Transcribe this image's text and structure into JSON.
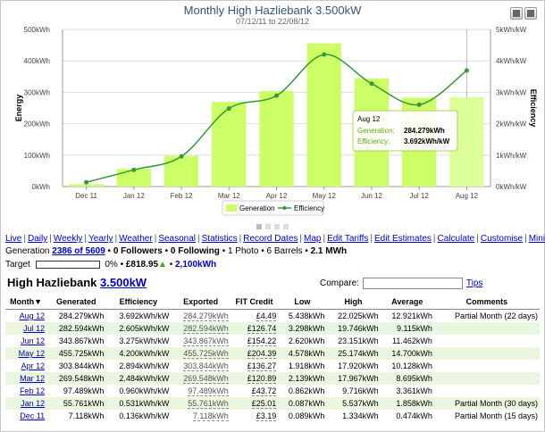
{
  "chart": {
    "title": "Monthly High Hazliebank 3.500kW",
    "subtitle": "07/12/11 to 22/08/12",
    "colors": {
      "bar": "#ccff66",
      "bar_highlight": "#ddff99",
      "line": "#339933",
      "tooltip_border": "#a8d060",
      "tooltip_label": "#66aa22"
    },
    "tooltip": {
      "month": "Aug 12",
      "rows": [
        {
          "label": "Generation:",
          "value": "284.279kWh"
        },
        {
          "label": "Efficiency:",
          "value": "3.692kWh/kW"
        }
      ]
    }
  },
  "chart_data": {
    "type": "bar",
    "categories": [
      "Dec 11",
      "Jan 12",
      "Feb 12",
      "Mar 12",
      "Apr 12",
      "May 12",
      "Jun 12",
      "Jul 12",
      "Aug 12"
    ],
    "series": [
      {
        "name": "Generation",
        "type": "bar",
        "axis": "left",
        "values": [
          7.118,
          55.761,
          97.489,
          269.548,
          303.844,
          455.725,
          343.867,
          282.594,
          284.279
        ]
      },
      {
        "name": "Efficiency",
        "type": "line",
        "axis": "right",
        "values": [
          0.136,
          0.531,
          0.96,
          2.484,
          2.894,
          4.2,
          3.275,
          2.605,
          3.692
        ]
      }
    ],
    "ylabel": "Energy",
    "y2label": "Efficiency",
    "ylim": [
      0,
      500
    ],
    "y2lim": [
      0,
      5
    ],
    "yticks": [
      "0kWh",
      "100kWh",
      "200kWh",
      "300kWh",
      "400kWh",
      "500kWh"
    ],
    "y2ticks": [
      "0kWh/kW",
      "1kWh/kW",
      "2kWh/kW",
      "3kWh/kW",
      "4kWh/kW",
      "5kWh/kW"
    ],
    "grid": true,
    "legend": "bottom"
  },
  "nav": {
    "links": [
      "Live",
      "Daily",
      "Weekly",
      "Yearly",
      "Weather",
      "Seasonal",
      "Statistics",
      "Record Dates",
      "Map",
      "Edit Tariffs",
      "Edit Estimates",
      "Calculate",
      "Customise",
      "Minimise"
    ]
  },
  "stats": {
    "prefix": "Generation ",
    "rank": "2386 of 5609",
    "followers": "0 Followers",
    "following": "0 Following",
    "photo": "1 Photo",
    "barrels": "6 Barrels",
    "mwh": "2.1 MWh"
  },
  "target": {
    "label": "Target",
    "progress": 0,
    "percent": "0%",
    "money": "£818.95",
    "kwh": "2,100kWh"
  },
  "system": {
    "name": "High Hazliebank",
    "size": "3.500kW"
  },
  "compare": {
    "label": "Compare:",
    "placeholder": "",
    "tips": "Tips"
  },
  "table": {
    "headers": [
      "Month▼",
      "Generated",
      "Efficiency",
      "Exported",
      "FIT Credit",
      "Low",
      "High",
      "Average",
      "Comments"
    ],
    "rows": [
      {
        "month": "Aug 12",
        "generated": "284.279kWh",
        "efficiency": "3.692kWh/kW",
        "exported": "284.279kWh",
        "fit": "£4.49",
        "low": "5.438kWh",
        "high": "22.025kWh",
        "average": "12.921kWh",
        "comment": "Partial Month (22 days)"
      },
      {
        "month": "Jul 12",
        "generated": "282.594kWh",
        "efficiency": "2.605kWh/kW",
        "exported": "282.594kWh",
        "fit": "£126.74",
        "low": "3.298kWh",
        "high": "19.746kWh",
        "average": "9.115kWh",
        "comment": ""
      },
      {
        "month": "Jun 12",
        "generated": "343.867kWh",
        "efficiency": "3.275kWh/kW",
        "exported": "343.867kWh",
        "fit": "£154.22",
        "low": "2.620kWh",
        "high": "23.151kWh",
        "average": "11.462kWh",
        "comment": ""
      },
      {
        "month": "May 12",
        "generated": "455.725kWh",
        "efficiency": "4.200kWh/kW",
        "exported": "455.725kWh",
        "fit": "£204.39",
        "low": "4.578kWh",
        "high": "25.174kWh",
        "average": "14.700kWh",
        "comment": ""
      },
      {
        "month": "Apr 12",
        "generated": "303.844kWh",
        "efficiency": "2.894kWh/kW",
        "exported": "303.844kWh",
        "fit": "£136.27",
        "low": "1.918kWh",
        "high": "17.920kWh",
        "average": "10.128kWh",
        "comment": ""
      },
      {
        "month": "Mar 12",
        "generated": "269.548kWh",
        "efficiency": "2.484kWh/kW",
        "exported": "269.548kWh",
        "fit": "£120.89",
        "low": "2.139kWh",
        "high": "17.967kWh",
        "average": "8.695kWh",
        "comment": ""
      },
      {
        "month": "Feb 12",
        "generated": "97.489kWh",
        "efficiency": "0.960kWh/kW",
        "exported": "97.489kWh",
        "fit": "£43.72",
        "low": "0.862kWh",
        "high": "9.716kWh",
        "average": "3.361kWh",
        "comment": ""
      },
      {
        "month": "Jan 12",
        "generated": "55.761kWh",
        "efficiency": "0.531kWh/kW",
        "exported": "55.761kWh",
        "fit": "£25.01",
        "low": "0.087kWh",
        "high": "5.537kWh",
        "average": "1.858kWh",
        "comment": "Partial Month (30 days)"
      },
      {
        "month": "Dec 11",
        "generated": "7.118kWh",
        "efficiency": "0.136kWh/kW",
        "exported": "7.118kWh",
        "fit": "£3.19",
        "low": "0.089kWh",
        "high": "1.334kWh",
        "average": "0.474kWh",
        "comment": "Partial Month (15 days)"
      }
    ]
  }
}
